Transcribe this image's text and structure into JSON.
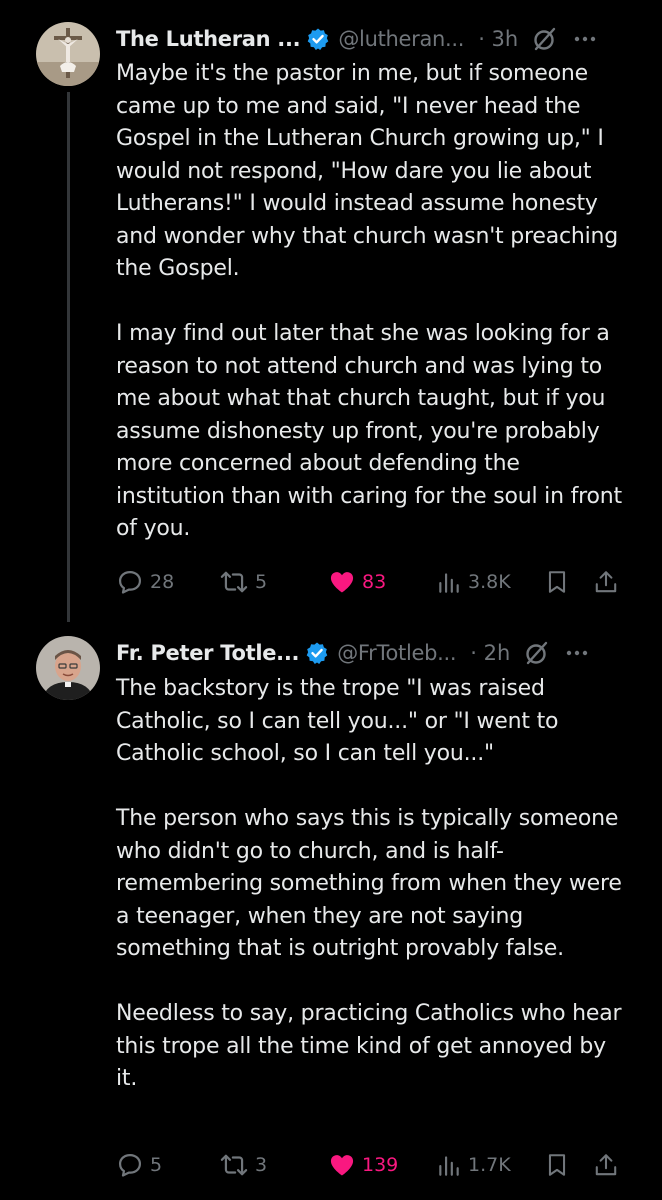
{
  "colors": {
    "background": "#000000",
    "text": "#e7e9ea",
    "muted": "#71767b",
    "verified": "#1d9bf0",
    "like": "#f91880",
    "thread_line": "#333639"
  },
  "tweets": [
    {
      "avatar_icon": "crucifix-avatar",
      "name": "The Lutheran ...",
      "handle": "@lutheran...",
      "time": "· 3h",
      "body": "Maybe it's the pastor in me, but if someone came up to me and said, \"I never head the Gospel in the Lutheran Church growing up,\" I would not respond, \"How dare you lie about Lutherans!\" I would instead assume honesty and wonder why that church wasn't preaching the Gospel.\n\nI may find out later that she was looking for a reason to not attend church and was lying to me about what that church taught, but if you assume dishonesty up front, you're probably more concerned about defending the institution than with caring for the soul in front of you.",
      "replies": "28",
      "reposts": "5",
      "likes": "83",
      "views": "3.8K",
      "liked": true
    },
    {
      "avatar_icon": "priest-portrait-avatar",
      "name": "Fr. Peter Totle...",
      "handle": "@FrTotleb...",
      "time": "· 2h",
      "body": "The backstory is the trope \"I was raised Catholic, so I can tell you...\" or \"I went to Catholic school, so I can tell you...\"\n\nThe person who says this is typically someone who didn't go to church, and is half-remembering something from when they were a teenager, when they are not saying something that is outright provably false.\n\nNeedless to say, practicing Catholics who hear this trope all the time kind of get annoyed by it.",
      "replies": "5",
      "reposts": "3",
      "likes": "139",
      "views": "1.7K",
      "liked": true
    }
  ]
}
